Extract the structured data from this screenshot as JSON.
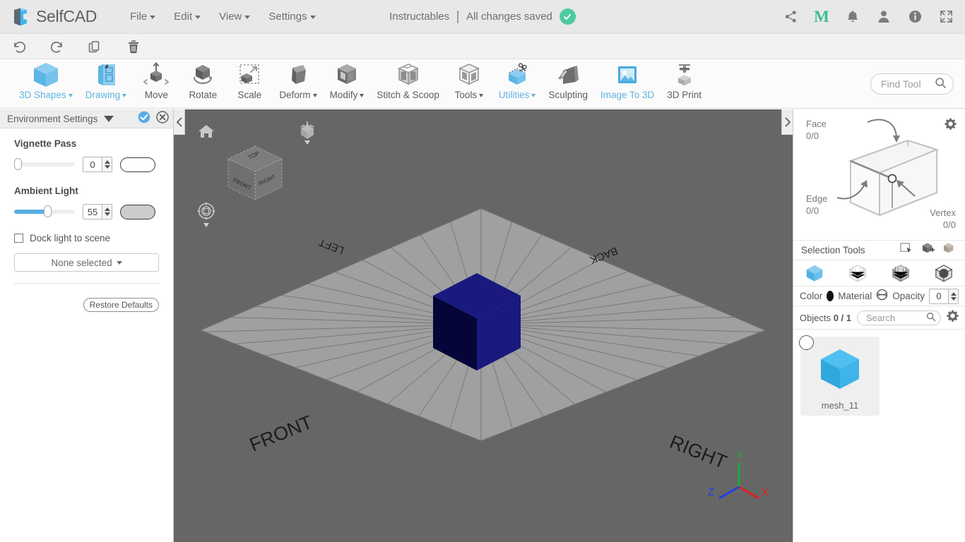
{
  "app": {
    "brand": "SelfCAD",
    "brand_accent": "#4fb3e8",
    "menu": [
      {
        "label": "File",
        "caret": true
      },
      {
        "label": "Edit",
        "caret": true
      },
      {
        "label": "View",
        "caret": true
      },
      {
        "label": "Settings",
        "caret": true
      }
    ],
    "document_name": "Instructables",
    "save_status": "All changes saved",
    "save_icon": "check-circle-icon",
    "save_color": "#4ecba0",
    "top_right_icons": [
      {
        "name": "share-icon"
      },
      {
        "name": "m-brand-icon",
        "label": "M",
        "color": "#3bbd93"
      },
      {
        "name": "notifications-bell-icon"
      },
      {
        "name": "user-account-icon"
      },
      {
        "name": "info-icon"
      },
      {
        "name": "fullscreen-icon"
      }
    ]
  },
  "action_bar": [
    {
      "name": "undo-button",
      "icon": "undo-arrow-icon"
    },
    {
      "name": "redo-button",
      "icon": "redo-arrow-icon"
    },
    {
      "name": "copy-button",
      "icon": "copy-pages-icon"
    },
    {
      "name": "delete-button",
      "icon": "trash-bin-icon"
    }
  ],
  "toolbar": {
    "tools": [
      {
        "label": "3D Shapes",
        "icon": "cube-blue-icon",
        "caret": true,
        "accent": true
      },
      {
        "label": "Drawing",
        "icon": "sketch-pen-icon",
        "caret": true,
        "accent": true
      },
      {
        "label": "Move",
        "icon": "move-arrows-icon",
        "caret": false,
        "accent": false
      },
      {
        "label": "Rotate",
        "icon": "rotate-cube-icon",
        "caret": false,
        "accent": false
      },
      {
        "label": "Scale",
        "icon": "scale-marquee-icon",
        "caret": false,
        "accent": false
      },
      {
        "label": "Deform",
        "icon": "deform-cube-icon",
        "caret": true,
        "accent": false
      },
      {
        "label": "Modify",
        "icon": "modify-cube-icon",
        "caret": true,
        "accent": false
      },
      {
        "label": "Stitch & Scoop",
        "icon": "stitch-scoop-icon",
        "caret": false,
        "accent": false
      },
      {
        "label": "Tools",
        "icon": "tools-cube-icon",
        "caret": true,
        "accent": false
      },
      {
        "label": "Utilities",
        "icon": "utilities-scissors-icon",
        "caret": true,
        "accent": true
      },
      {
        "label": "Sculpting",
        "icon": "sculpting-chisel-icon",
        "caret": false,
        "accent": false
      },
      {
        "label": "Image To 3D",
        "icon": "image-to-3d-icon",
        "caret": false,
        "accent": true
      },
      {
        "label": "3D Print",
        "icon": "3d-printer-icon",
        "caret": false,
        "accent": false
      }
    ],
    "find_tool_placeholder": "Find Tool",
    "find_tool_icon": "search-icon"
  },
  "left_panel": {
    "title": "Environment Settings",
    "header_icons": [
      {
        "name": "collapse-caret-icon"
      },
      {
        "name": "apply-check-icon",
        "color": "#5aade2"
      },
      {
        "name": "close-x-icon"
      }
    ],
    "vignette": {
      "label": "Vignette Pass",
      "value": "0",
      "slider_percent": 0,
      "swatch": "white"
    },
    "ambient": {
      "label": "Ambient Light",
      "value": "55",
      "slider_percent": 55,
      "swatch": "grey"
    },
    "dock_light": {
      "label": "Dock light to scene",
      "checked": false
    },
    "dropdown": {
      "label": "None selected",
      "caret": true
    },
    "restore_button": "Restore Defaults",
    "collapse_icon": "chevron-left-icon"
  },
  "viewport": {
    "background_color": "#666666",
    "home_icon": "home-icon",
    "perspective_icon": "perspective-view-icon",
    "snap_icon": "snap-target-icon",
    "nav_cube": {
      "faces": [
        "TOP",
        "FRONT",
        "RIGHT"
      ]
    },
    "grid_labels": [
      "LEFT",
      "BACK",
      "FRONT",
      "RIGHT"
    ],
    "object": {
      "name": "cube-mesh",
      "color": "#151569"
    },
    "axis_gizmo": {
      "x": {
        "label": "X",
        "color": "#e02020"
      },
      "y": {
        "label": "Y",
        "color": "#1faa3c"
      },
      "z": {
        "label": "Z",
        "color": "#2040e0"
      }
    }
  },
  "right_panel": {
    "collapse_icon": "chevron-right-icon",
    "selection_counts": [
      {
        "label": "Face",
        "value": "0/0"
      },
      {
        "label": "Edge",
        "value": "0/0"
      },
      {
        "label": "Vertex",
        "value": "0/0"
      }
    ],
    "settings_gear_icon": "gear-icon",
    "selection_tools": {
      "label": "Selection Tools",
      "icons": [
        {
          "name": "rectangle-select-icon"
        },
        {
          "name": "add-selection-icon"
        },
        {
          "name": "subtract-selection-icon"
        }
      ]
    },
    "selection_modes": [
      {
        "name": "object-mode-icon",
        "active": true
      },
      {
        "name": "vertex-mode-icon",
        "active": false
      },
      {
        "name": "face-mode-icon",
        "active": false
      },
      {
        "name": "edge-mode-icon",
        "active": false
      }
    ],
    "appearance": {
      "color_label": "Color",
      "color_value": "#121212",
      "material_label": "Material",
      "material_icon": "material-sphere-icon",
      "opacity_label": "Opacity",
      "opacity_value": "0"
    },
    "objects": {
      "label_prefix": "Objects",
      "count": "0 / 1",
      "search_placeholder": "Search",
      "search_icon": "search-icon",
      "gear_icon": "gear-icon",
      "items": [
        {
          "name": "mesh_11",
          "thumb": "cube-thumbnail",
          "selected": false
        }
      ]
    }
  }
}
